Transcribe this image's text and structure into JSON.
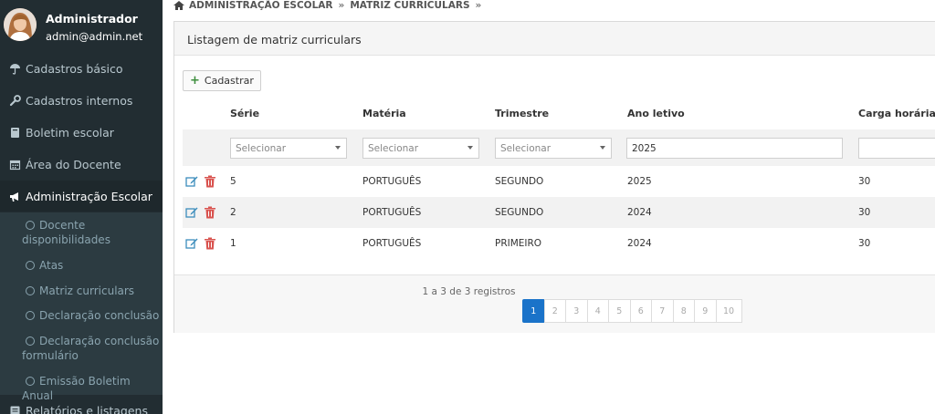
{
  "user": {
    "name": "Administrador",
    "email": "admin@admin.net"
  },
  "sidebar": {
    "items": [
      {
        "label": "Cadastros básico",
        "icon": "umbrella-icon"
      },
      {
        "label": "Cadastros internos",
        "icon": "wrench-icon"
      },
      {
        "label": "Boletim escolar",
        "icon": "book-icon"
      },
      {
        "label": "Área do Docente",
        "icon": "calendar-icon"
      },
      {
        "label": "Administração Escolar",
        "icon": "bullhorn-icon",
        "active": true
      },
      {
        "label": "Relatórios e listagens",
        "icon": "list-icon"
      }
    ],
    "subitems": [
      {
        "line1": "Docente",
        "line2": "disponibilidades"
      },
      {
        "line1": "Atas"
      },
      {
        "line1": "Matriz curriculars"
      },
      {
        "line1": "Declaração conclusão"
      },
      {
        "line1": "Declaração conclusão",
        "line2": "formulário"
      },
      {
        "line1": "Emissão Boletim Anual"
      }
    ]
  },
  "breadcrumb": {
    "home": "ADMINISTRAÇÃO ESCOLAR",
    "sep": "»",
    "current": "MATRIZ CURRICULARS"
  },
  "panel": {
    "title": "Listagem de matriz curriculars"
  },
  "toolbar": {
    "add_label": "Cadastrar"
  },
  "table": {
    "headers": [
      "Série",
      "Matéria",
      "Trimestre",
      "Ano letivo",
      "Carga horária"
    ],
    "filters": {
      "serie_placeholder": "Selecionar",
      "materia_placeholder": "Selecionar",
      "trimestre_placeholder": "Selecionar",
      "ano_value": "2025",
      "carga_value": ""
    },
    "rows": [
      {
        "serie": "5",
        "materia": "PORTUGUÊS",
        "trimestre": "SEGUNDO",
        "ano": "2025",
        "carga": "30"
      },
      {
        "serie": "2",
        "materia": "PORTUGUÊS",
        "trimestre": "SEGUNDO",
        "ano": "2024",
        "carga": "30"
      },
      {
        "serie": "1",
        "materia": "PORTUGUÊS",
        "trimestre": "PRIMEIRO",
        "ano": "2024",
        "carga": "30"
      }
    ]
  },
  "footer": {
    "records": "1 a 3 de 3 registros"
  },
  "pagination": {
    "pages": [
      "1",
      "2",
      "3",
      "4",
      "5",
      "6",
      "7",
      "8",
      "9",
      "10"
    ],
    "current": "1"
  },
  "colors": {
    "sidebar_bg": "#222d32",
    "submenu_bg": "#2c3b41",
    "active_page": "#1a73c9",
    "edit_icon": "#3c8dbc",
    "trash_icon": "#d9534f"
  }
}
